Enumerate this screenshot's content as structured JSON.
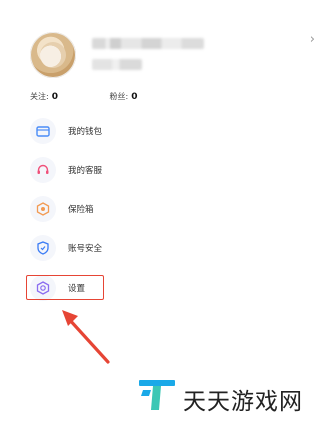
{
  "profile": {
    "chevron_icon": "chevron-right-icon",
    "avatar_icon": "user-avatar"
  },
  "stats": {
    "following_label": "关注:",
    "following_value": "0",
    "fans_label": "粉丝:",
    "fans_value": "0"
  },
  "menu": {
    "items": [
      {
        "label": "我的钱包",
        "icon": "wallet-icon",
        "color": "#4a8cf7"
      },
      {
        "label": "我的客服",
        "icon": "headset-icon",
        "color": "#f0507a"
      },
      {
        "label": "保险箱",
        "icon": "safe-icon",
        "color": "#f29a52"
      },
      {
        "label": "账号安全",
        "icon": "shield-icon",
        "color": "#3b7cf5"
      },
      {
        "label": "设置",
        "icon": "settings-icon",
        "color": "#8a6cf0"
      }
    ]
  },
  "annotation": {
    "highlight_color": "#e64535"
  },
  "watermark": {
    "text": "天天游戏网",
    "logo_colors": [
      "#1aa9e8",
      "#3cc7b5"
    ]
  }
}
